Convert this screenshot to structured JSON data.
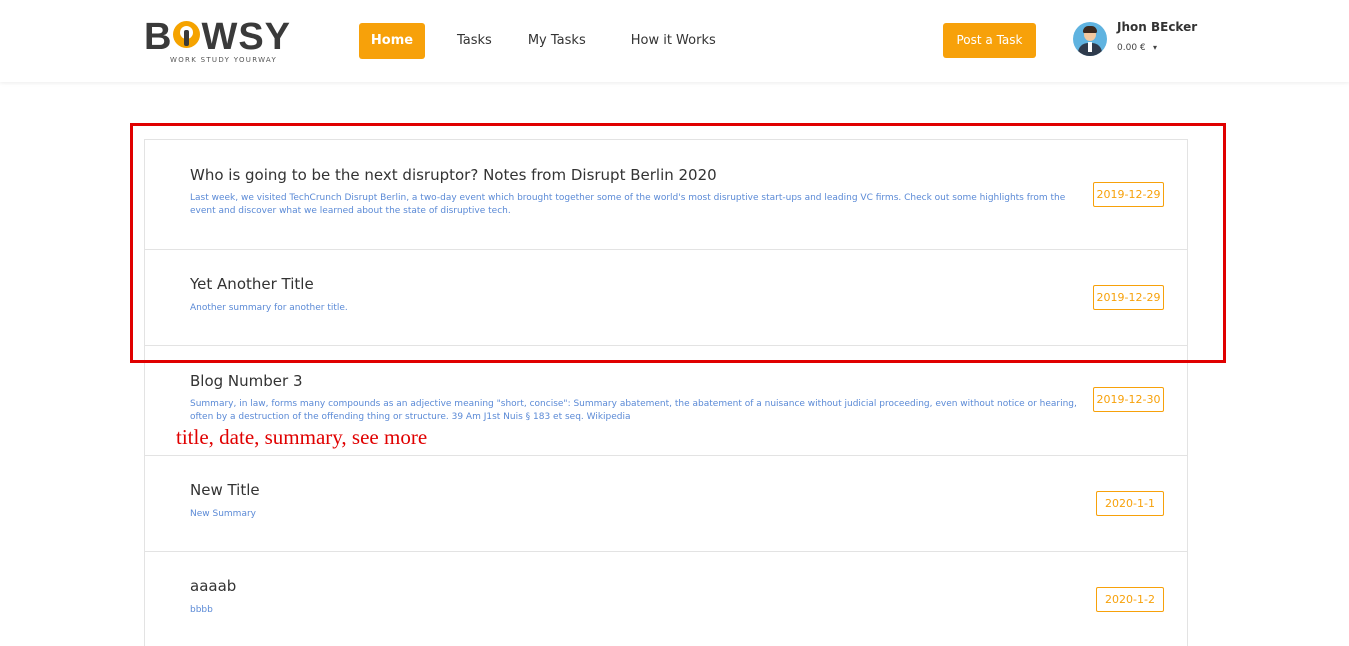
{
  "brand": {
    "name": "BOWSY",
    "tagline": "WORK   STUDY   YOURWAY"
  },
  "nav": {
    "home": "Home",
    "tasks": "Tasks",
    "my_tasks": "My Tasks",
    "how_it_works": "How it Works"
  },
  "header": {
    "post_task_label": "Post a Task",
    "user_name": "Jhon BEcker",
    "balance": "0.00 €",
    "caret": "▾"
  },
  "posts": [
    {
      "title": "Who is going to be the next disruptor? Notes from Disrupt Berlin 2020",
      "summary": "Last week, we visited TechCrunch Disrupt Berlin, a two-day event which brought together some of the world's most disruptive start-ups and leading VC firms. Check out some highlights from the event and discover what we learned about the state of disruptive tech.",
      "date": "2019-12-29"
    },
    {
      "title": "Yet Another Title",
      "summary": "Another summary for another title.",
      "date": "2019-12-29"
    },
    {
      "title": "Blog Number 3",
      "summary": "Summary, in law, forms many compounds as an adjective meaning \"short, concise\": Summary abatement, the abatement of a nuisance without judicial proceeding, even without notice or hearing, often by a destruction of the offending thing or structure. 39 Am J1st Nuis § 183 et seq. Wikipedia",
      "date": "2019-12-30"
    },
    {
      "title": "New Title",
      "summary": "New Summary",
      "date": "2020-1-1"
    },
    {
      "title": "aaaab",
      "summary": "bbbb",
      "date": "2020-1-2"
    }
  ],
  "annotation": {
    "text": "title, date, summary, see more",
    "color": "#e00000"
  },
  "colors": {
    "accent": "#f7a10a",
    "summary_text": "#5b8ad6",
    "highlight": "#e00000"
  }
}
